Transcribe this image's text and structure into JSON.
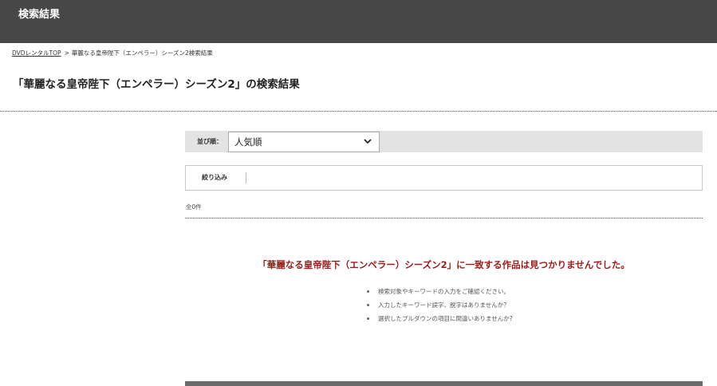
{
  "header": {
    "title": "検索結果"
  },
  "breadcrumb": {
    "home": "DVDレンタルTOP",
    "separator": ">",
    "current": "華麗なる皇帝陛下（エンペラー）シーズン2検索結果"
  },
  "page_title": "「華麗なる皇帝陛下（エンペラー）シーズン2」の検索結果",
  "sort": {
    "label": "並び順：",
    "selected": "人気順"
  },
  "filter": {
    "label": "絞り込み"
  },
  "result_count": "全0件",
  "no_result": {
    "message": "「華麗なる皇帝陛下（エンペラー）シーズン2」に一致する作品は見つかりませんでした。",
    "hints": [
      "検索対象やキーワードの入力をご確認ください。",
      "入力したキーワード誤字、脱字はありませんか？",
      "選択したプルダウンの項目に間違いありませんか?"
    ]
  },
  "icons": {
    "sort_dropdown": "chevron-down-icon"
  },
  "colors": {
    "header_bg": "#474747",
    "sort_bar_bg": "#e3e3e3",
    "no_result_text": "#9b1a1a"
  }
}
